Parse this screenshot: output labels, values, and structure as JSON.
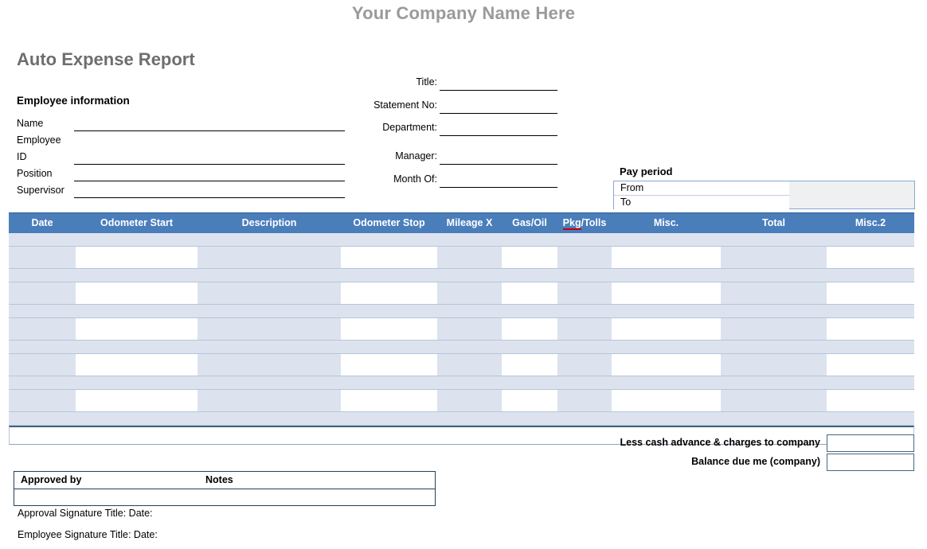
{
  "header": {
    "company_name": "Your Company Name Here",
    "report_title": "Auto Expense Report",
    "company_color": "#9a9a9a",
    "title_color": "#6e6e6e"
  },
  "employee_information": {
    "heading": "Employee information",
    "fields": [
      {
        "label": "Name",
        "value": ""
      },
      {
        "label": "Employee ID",
        "value": ""
      },
      {
        "label": "Position",
        "value": ""
      },
      {
        "label": "Supervisor",
        "value": ""
      }
    ]
  },
  "statement_information": {
    "fields": [
      {
        "label": "Title:",
        "value": ""
      },
      {
        "label": "Statement No:",
        "value": ""
      },
      {
        "label": "Department:",
        "value": ""
      },
      {
        "label": "Manager:",
        "value": ""
      },
      {
        "label": "Month Of:",
        "value": ""
      }
    ]
  },
  "pay_period": {
    "heading": "Pay period",
    "rows": [
      {
        "label": "From",
        "value": ""
      },
      {
        "label": "To",
        "value": ""
      }
    ]
  },
  "expense_table": {
    "header_color": "#4a7ebb",
    "row_color": "#dce3ee",
    "columns": [
      {
        "label": "Date",
        "input": false
      },
      {
        "label": "Odometer Start",
        "input": true
      },
      {
        "label": "Description",
        "input": false
      },
      {
        "label": "Odometer Stop",
        "input": true
      },
      {
        "label": "Mileage X",
        "input": false
      },
      {
        "label": "Gas/Oil",
        "input": true
      },
      {
        "label": "Pkg/Tolls",
        "input": false,
        "misspelled": "Pkg"
      },
      {
        "label": "Misc.",
        "input": true
      },
      {
        "label": "Total",
        "input": false
      },
      {
        "label": "Misc.2",
        "input": true
      }
    ],
    "row_count": 11,
    "rows": [
      [
        "",
        "",
        "",
        "",
        "",
        "",
        "",
        "",
        "",
        ""
      ],
      [
        "",
        "",
        "",
        "",
        "",
        "",
        "",
        "",
        "",
        ""
      ],
      [
        "",
        "",
        "",
        "",
        "",
        "",
        "",
        "",
        "",
        ""
      ],
      [
        "",
        "",
        "",
        "",
        "",
        "",
        "",
        "",
        "",
        ""
      ],
      [
        "",
        "",
        "",
        "",
        "",
        "",
        "",
        "",
        "",
        ""
      ],
      [
        "",
        "",
        "",
        "",
        "",
        "",
        "",
        "",
        "",
        ""
      ],
      [
        "",
        "",
        "",
        "",
        "",
        "",
        "",
        "",
        "",
        ""
      ],
      [
        "",
        "",
        "",
        "",
        "",
        "",
        "",
        "",
        "",
        ""
      ],
      [
        "",
        "",
        "",
        "",
        "",
        "",
        "",
        "",
        "",
        ""
      ],
      [
        "",
        "",
        "",
        "",
        "",
        "",
        "",
        "",
        "",
        ""
      ],
      [
        "",
        "",
        "",
        "",
        "",
        "",
        "",
        "",
        "",
        ""
      ]
    ],
    "totals_row": [
      "",
      "",
      "",
      "",
      "",
      "",
      "",
      "",
      "",
      ""
    ]
  },
  "summary": {
    "rows": [
      {
        "label": "Less cash advance & charges to company",
        "value": ""
      },
      {
        "label": "Balance due me (company)",
        "value": ""
      }
    ]
  },
  "approval": {
    "approved_by_label": "Approved by",
    "notes_label": "Notes",
    "approved_by_value": "",
    "notes_value": ""
  },
  "signatures": {
    "approval_line": "Approval Signature Title:  Date:",
    "employee_line": "Employee Signature Title:  Date:"
  }
}
